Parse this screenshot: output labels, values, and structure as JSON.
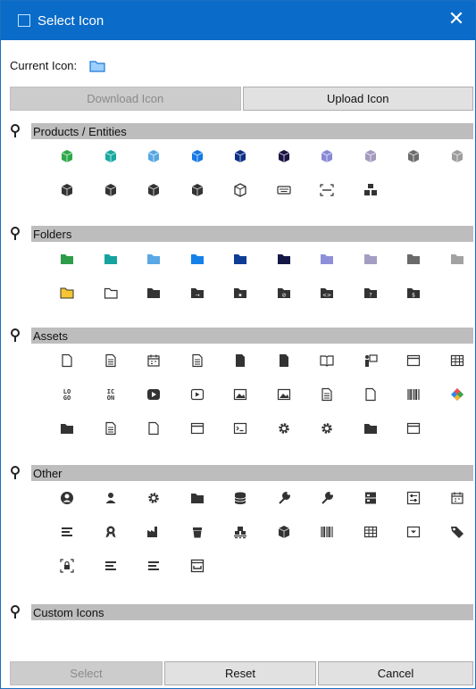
{
  "window": {
    "title": "Select Icon"
  },
  "current_icon": {
    "label": "Current Icon:",
    "icon": "folder-open-icon"
  },
  "buttons": {
    "download": "Download Icon",
    "upload": "Upload Icon",
    "select": "Select",
    "reset": "Reset",
    "cancel": "Cancel"
  },
  "sections": [
    {
      "title": "Products / Entities",
      "icons": [
        {
          "name": "cube-green-icon",
          "shape": "cube",
          "color": "#2ea84a"
        },
        {
          "name": "cube-teal-icon",
          "shape": "cube",
          "color": "#17a9a0"
        },
        {
          "name": "cube-lightblue-icon",
          "shape": "cube",
          "color": "#58a7e3"
        },
        {
          "name": "cube-blue-icon",
          "shape": "cube",
          "color": "#1679e6"
        },
        {
          "name": "cube-navy-icon",
          "shape": "cube",
          "color": "#0f2f85"
        },
        {
          "name": "cube-darknavy-icon",
          "shape": "cube",
          "color": "#1c1444"
        },
        {
          "name": "cube-lavender-icon",
          "shape": "cube",
          "color": "#8789d6"
        },
        {
          "name": "cube-mauve-icon",
          "shape": "cube",
          "color": "#a39abf"
        },
        {
          "name": "cube-gray-icon",
          "shape": "cube",
          "color": "#6d6d6d"
        },
        {
          "name": "cube-lightgray-icon",
          "shape": "cube",
          "color": "#9d9d9d"
        },
        {
          "name": "cube-dark-icon",
          "shape": "cube",
          "color": "#333333"
        },
        {
          "name": "cube-import-icon",
          "shape": "cube",
          "color": "#333333"
        },
        {
          "name": "cube-add-icon",
          "shape": "cube",
          "color": "#333333"
        },
        {
          "name": "cube-block-icon",
          "shape": "cube",
          "color": "#333333"
        },
        {
          "name": "cube-outline-icon",
          "shape": "cube-outline",
          "color": "#333333"
        },
        {
          "name": "keyboard-icon",
          "shape": "keyboard",
          "color": "#333333"
        },
        {
          "name": "scan-icon",
          "shape": "scan",
          "color": "#333333"
        },
        {
          "name": "cubes-stack-icon",
          "shape": "cubes",
          "color": "#333333"
        }
      ]
    },
    {
      "title": "Folders",
      "icons": [
        {
          "name": "folder-green-icon",
          "shape": "folder",
          "color": "#2e9c4b"
        },
        {
          "name": "folder-teal-icon",
          "shape": "folder",
          "color": "#16a3a0"
        },
        {
          "name": "folder-lightblue-icon",
          "shape": "folder",
          "color": "#5aa8e4"
        },
        {
          "name": "folder-blue-icon",
          "shape": "folder",
          "color": "#1480ea"
        },
        {
          "name": "folder-navy-icon",
          "shape": "folder",
          "color": "#0f3d96"
        },
        {
          "name": "folder-darknavy-icon",
          "shape": "folder",
          "color": "#151846"
        },
        {
          "name": "folder-lavender-icon",
          "shape": "folder",
          "color": "#8d90d8"
        },
        {
          "name": "folder-mauve-icon",
          "shape": "folder",
          "color": "#a39ec2"
        },
        {
          "name": "folder-gray-icon",
          "shape": "folder",
          "color": "#6a6a6a"
        },
        {
          "name": "folder-lightgray-icon",
          "shape": "folder",
          "color": "#a2a2a2"
        },
        {
          "name": "folder-yellow-icon",
          "shape": "folder-yellow",
          "color": "#f6c531"
        },
        {
          "name": "folder-outline-icon",
          "shape": "folder-outline",
          "color": "#333333"
        },
        {
          "name": "folder-dark-icon",
          "shape": "folder",
          "color": "#333333"
        },
        {
          "name": "folder-arrow-icon",
          "shape": "folder-badge",
          "color": "#333333",
          "badge": "→"
        },
        {
          "name": "folder-star-icon",
          "shape": "folder-badge",
          "color": "#333333",
          "badge": "★"
        },
        {
          "name": "folder-block-icon",
          "shape": "folder-badge",
          "color": "#333333",
          "badge": "⊘"
        },
        {
          "name": "folder-code-icon",
          "shape": "folder-badge",
          "color": "#333333",
          "badge": "<>"
        },
        {
          "name": "folder-question-icon",
          "shape": "folder-badge",
          "color": "#333333",
          "badge": "?"
        },
        {
          "name": "folder-dollar-icon",
          "shape": "folder-badge",
          "color": "#333333",
          "badge": "$"
        }
      ]
    },
    {
      "title": "Assets",
      "icons": [
        {
          "name": "file-outline-icon",
          "shape": "file-outline",
          "color": "#333333"
        },
        {
          "name": "file-list-icon",
          "shape": "file-lines",
          "color": "#333333"
        },
        {
          "name": "calendar-icon",
          "shape": "calendar",
          "color": "#333333"
        },
        {
          "name": "document-icon",
          "shape": "file-lines",
          "color": "#333333"
        },
        {
          "name": "file-edit-icon",
          "shape": "file-solid",
          "color": "#333333"
        },
        {
          "name": "file-solid-icon",
          "shape": "file-solid",
          "color": "#333333"
        },
        {
          "name": "book-icon",
          "shape": "book",
          "color": "#333333"
        },
        {
          "name": "presenter-icon",
          "shape": "presenter",
          "color": "#333333"
        },
        {
          "name": "http-window-icon",
          "shape": "window",
          "color": "#333333"
        },
        {
          "name": "table-icon",
          "shape": "table",
          "color": "#333333"
        },
        {
          "name": "logo-icon",
          "shape": "text",
          "color": "#333333",
          "text": "LO\nGO"
        },
        {
          "name": "icon-text-icon",
          "shape": "text",
          "color": "#333333",
          "text": "IC\nON"
        },
        {
          "name": "video-play-icon",
          "shape": "play-solid",
          "color": "#333333"
        },
        {
          "name": "video-outline-icon",
          "shape": "play-outline",
          "color": "#333333"
        },
        {
          "name": "image-icon",
          "shape": "image",
          "color": "#333333"
        },
        {
          "name": "images-icon",
          "shape": "image",
          "color": "#333333"
        },
        {
          "name": "form-edit-icon",
          "shape": "file-lines",
          "color": "#333333"
        },
        {
          "name": "file-signature-icon",
          "shape": "file-outline",
          "color": "#333333"
        },
        {
          "name": "barcode-battery-icon",
          "shape": "barcode",
          "color": "#333333"
        },
        {
          "name": "color-palette-icon",
          "shape": "diamond",
          "color": "#333333"
        },
        {
          "name": "folder-settings-icon",
          "shape": "folder",
          "color": "#333333"
        },
        {
          "name": "file-settings-icon",
          "shape": "file-lines",
          "color": "#333333"
        },
        {
          "name": "settings-file-icon",
          "shape": "file-outline",
          "color": "#333333"
        },
        {
          "name": "monitor-settings-icon",
          "shape": "window",
          "color": "#333333"
        },
        {
          "name": "terminal-icon",
          "shape": "terminal",
          "color": "#333333"
        },
        {
          "name": "gear-icon",
          "shape": "gear",
          "color": "#333333"
        },
        {
          "name": "cog-icon",
          "shape": "gear",
          "color": "#333333"
        },
        {
          "name": "folder-image-icon",
          "shape": "folder",
          "color": "#333333"
        },
        {
          "name": "window-list-icon",
          "shape": "window",
          "color": "#333333"
        }
      ]
    },
    {
      "title": "Other",
      "icons": [
        {
          "name": "user-circle-icon",
          "shape": "user-circle",
          "color": "#333333"
        },
        {
          "name": "user-icon",
          "shape": "user",
          "color": "#333333"
        },
        {
          "name": "gears-icon",
          "shape": "gear",
          "color": "#333333"
        },
        {
          "name": "folder-lock-icon",
          "shape": "folder",
          "color": "#333333"
        },
        {
          "name": "database-icon",
          "shape": "database",
          "color": "#333333"
        },
        {
          "name": "wrench-icon",
          "shape": "wrench",
          "color": "#333333"
        },
        {
          "name": "wrench-alt-icon",
          "shape": "wrench",
          "color": "#333333"
        },
        {
          "name": "server-icon",
          "shape": "server",
          "color": "#333333"
        },
        {
          "name": "sliders-icon",
          "shape": "sliders",
          "color": "#333333"
        },
        {
          "name": "calendar-grid-icon",
          "shape": "calendar",
          "color": "#333333"
        },
        {
          "name": "list-align-icon",
          "shape": "lines",
          "color": "#333333"
        },
        {
          "name": "award-icon",
          "shape": "award",
          "color": "#333333"
        },
        {
          "name": "factory-icon",
          "shape": "factory",
          "color": "#333333"
        },
        {
          "name": "bin-icon",
          "shape": "bin",
          "color": "#333333"
        },
        {
          "name": "pallet-icon",
          "shape": "pallet",
          "color": "#333333"
        },
        {
          "name": "box-icon",
          "shape": "cube",
          "color": "#333333"
        },
        {
          "name": "barcode-icon",
          "shape": "barcode",
          "color": "#333333"
        },
        {
          "name": "grid-icon",
          "shape": "table",
          "color": "#333333"
        },
        {
          "name": "dropdown-box-icon",
          "shape": "dropbox",
          "color": "#333333"
        },
        {
          "name": "tags-icon",
          "shape": "tag",
          "color": "#333333"
        },
        {
          "name": "lock-scan-icon",
          "shape": "lock",
          "color": "#333333"
        },
        {
          "name": "list-time-icon",
          "shape": "lines",
          "color": "#333333"
        },
        {
          "name": "list-block-icon",
          "shape": "lines",
          "color": "#333333"
        },
        {
          "name": "inbox-icon",
          "shape": "inbox",
          "color": "#333333"
        }
      ]
    },
    {
      "title": "Custom Icons",
      "icons": []
    }
  ]
}
